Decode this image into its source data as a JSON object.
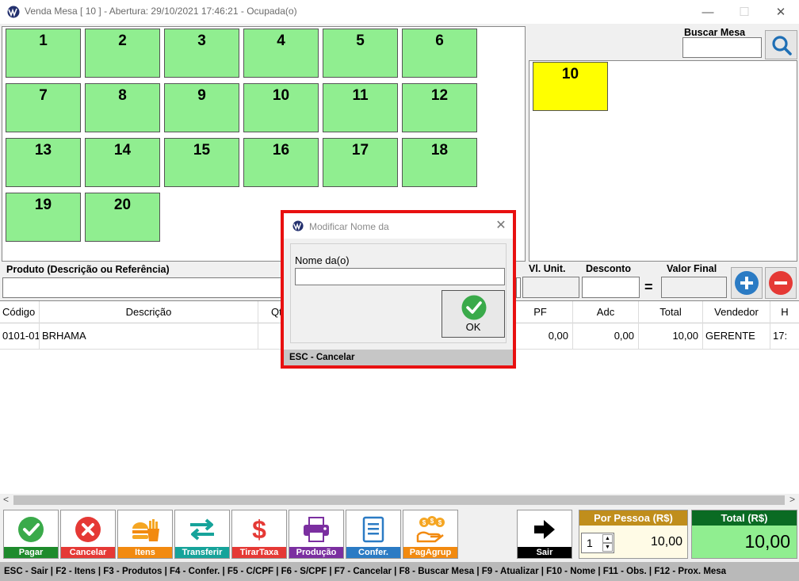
{
  "window": {
    "title": "Venda Mesa [ 10 ] - Abertura: 29/10/2021 17:46:21 - Ocupada(o)",
    "minimize": "—",
    "maximize": "☐",
    "close": "✕"
  },
  "tables": [
    "1",
    "2",
    "3",
    "4",
    "5",
    "6",
    "7",
    "8",
    "9",
    "10",
    "11",
    "12",
    "13",
    "14",
    "15",
    "16",
    "17",
    "18",
    "19",
    "20"
  ],
  "search": {
    "label": "Buscar Mesa",
    "value": ""
  },
  "open_tables": [
    "10"
  ],
  "product_row": {
    "produto_label": "Produto (Descrição ou Referência)",
    "vl_unit_label": "Vl. Unit.",
    "desconto_label": "Desconto",
    "valor_final_label": "Valor Final",
    "equals": "="
  },
  "grid": {
    "headers": [
      "Código",
      "Descrição",
      "Qt",
      "PF",
      "Adc",
      "Total",
      "Vendedor",
      "H"
    ],
    "rows": [
      {
        "codigo": "0101-01",
        "descricao": "BRHAMA",
        "qt": "",
        "pf": "0,00",
        "adc": "0,00",
        "total": "10,00",
        "vendedor": "GERENTE",
        "h": "17:"
      }
    ]
  },
  "scroll": {
    "left": "<",
    "right": ">"
  },
  "actions": [
    {
      "label": "Pagar",
      "color": "#1e8b2c",
      "icon": "check-icon"
    },
    {
      "label": "Cancelar",
      "color": "#e53935",
      "icon": "cancel-icon"
    },
    {
      "label": "Itens",
      "color": "#f28a10",
      "icon": "burger-fries-icon"
    },
    {
      "label": "Transferir",
      "color": "#16a39a",
      "icon": "transfer-arrows-icon"
    },
    {
      "label": "TirarTaxa",
      "color": "#e53935",
      "icon": "dollar-icon"
    },
    {
      "label": "Produção",
      "color": "#7b2fa0",
      "icon": "printer-icon"
    },
    {
      "label": "Confer.",
      "color": "#2b7bc4",
      "icon": "checklist-icon"
    },
    {
      "label": "PagAgrup",
      "color": "#f28a10",
      "icon": "money-hand-icon"
    }
  ],
  "exit": {
    "label": "Sair"
  },
  "per_person": {
    "title": "Por Pessoa (R$)",
    "count": "1",
    "value": "10,00"
  },
  "total": {
    "title": "Total (R$)",
    "value": "10,00"
  },
  "shortcuts": "ESC - Sair | F2 - Itens | F3 - Produtos | F4 - Confer. | F5 - C/CPF | F6 - S/CPF | F7 - Cancelar | F8 - Buscar Mesa | F9 - Atualizar | F10 - Nome | F11 - Obs. | F12 - Prox. Mesa",
  "modal": {
    "title": "Modificar Nome da",
    "close": "✕",
    "field_label": "Nome da(o)",
    "field_value": "",
    "ok_label": "OK",
    "footer": "ESC - Cancelar"
  },
  "colors": {
    "table_free": "#90ee90",
    "table_open": "#ffff00",
    "modal_border": "#e81010"
  }
}
